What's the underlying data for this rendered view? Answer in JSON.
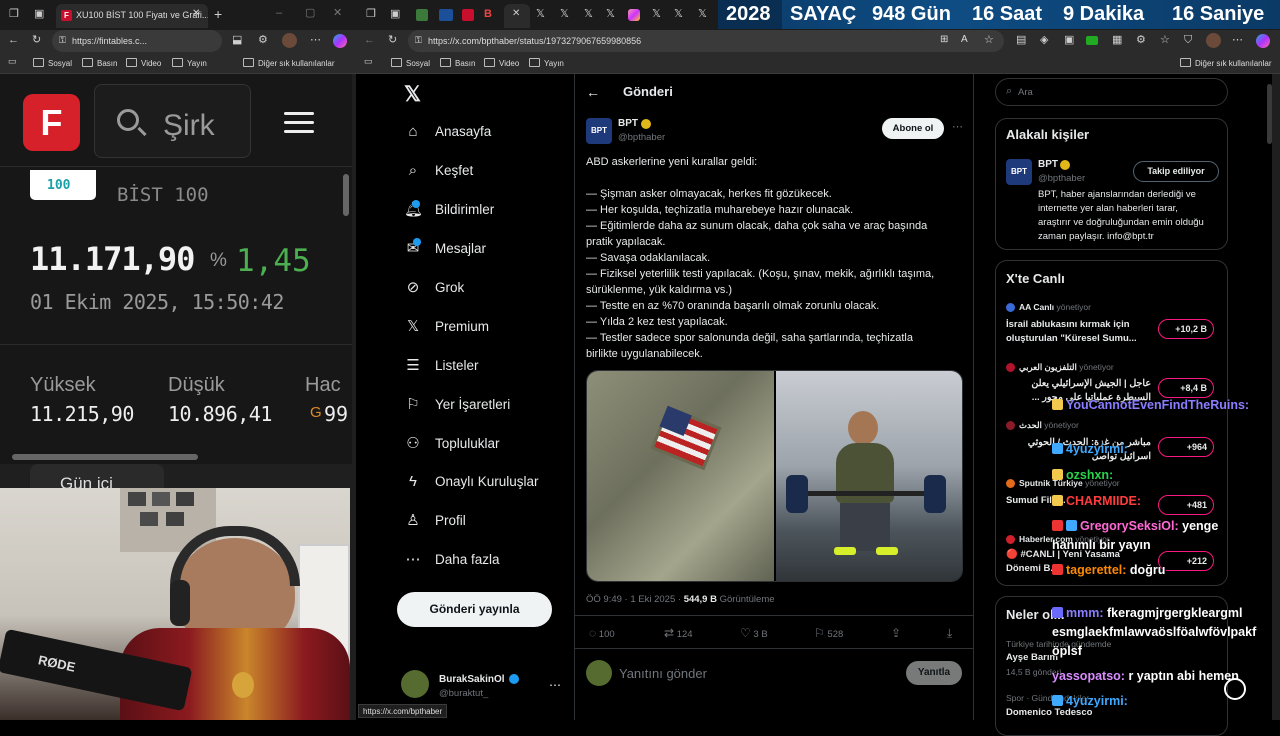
{
  "left_browser": {
    "tab_title": "XU100 BİST 100 Fiyatı ve Grafi...",
    "url": "https://fintables.c...",
    "bookmarks": [
      "Sosyal",
      "Basın",
      "Video",
      "Yayın"
    ],
    "bookmarks_other": "Diğer sık kullanılanlar"
  },
  "fintables": {
    "logo_letter": "F",
    "search_placeholder": "Şirk",
    "index_badge": "100",
    "index_name": "BİST 100",
    "price": "11.171,90",
    "change_symbol": "%",
    "change_value": "1,45",
    "change_color": "#4caf50",
    "datetime": "01 Ekim 2025, 15:50:42",
    "stats": [
      {
        "label": "Yüksek",
        "value": "11.215,90"
      },
      {
        "label": "Düşük",
        "value": "10.896,41"
      },
      {
        "label": "Hac",
        "value": "99"
      }
    ],
    "tab_partial": "Gün içi"
  },
  "webcam": {
    "mic_brand": "RØDE"
  },
  "right_browser": {
    "url": "https://x.com/bpthaber/status/1973279067659980856",
    "bookmarks": [
      "Sosyal",
      "Basın",
      "Video",
      "Yayın"
    ],
    "bookmarks_other": "Diğer sık kullanılanlar",
    "status_url": "https://x.com/bpthaber"
  },
  "countdown": {
    "year": "2028",
    "label": "SAYAÇ",
    "days": "948 Gün",
    "hours": "16 Saat",
    "minutes": "9 Dakika",
    "seconds": "16 Saniye"
  },
  "x_nav": {
    "items": [
      "Anasayfa",
      "Keşfet",
      "Bildirimler",
      "Mesajlar",
      "Grok",
      "Premium",
      "Listeler",
      "Yer İşaretleri",
      "Topluluklar",
      "Onaylı Kuruluşlar",
      "Profil",
      "Daha fazla"
    ],
    "post_button": "Gönderi yayınla",
    "account_name": "BurakSakinOl",
    "account_handle": "@buraktut_"
  },
  "post": {
    "header_title": "Gönderi",
    "author_name": "BPT",
    "author_handle": "@bpthaber",
    "avatar_text": "BPT",
    "follow_label": "Abone ol",
    "text_lines": [
      "ABD askerlerine yeni kurallar geldi:",
      "",
      "— Şişman asker olmayacak, herkes fit gözükecek.",
      "— Her koşulda, teçhizatla muharebeye hazır olunacak.",
      "— Eğitimlerde daha az sunum olacak, daha çok saha ve araç başında",
      "pratik yapılacak.",
      "— Savaşa odaklanılacak.",
      "— Fiziksel yeterlilik testi yapılacak. (Koşu, şınav, mekik, ağırlıklı taşıma,",
      "sürüklenme, yük kaldırma vs.)",
      "— Testte en az %70 oranında başarılı olmak zorunlu olacak.",
      "— Yılda 2 kez test yapılacak.",
      "— Testler sadece spor salonunda değil, saha şartlarında, teçhizatla",
      "birlikte uygulanabilecek."
    ],
    "time": "ÖÖ 9:49 · 1 Eki 2025 ·",
    "views": "544,9 B",
    "views_label": "Görüntüleme",
    "replies": "100",
    "reposts": "124",
    "likes": "3 B",
    "bookmarks": "528",
    "reply_placeholder": "Yanıtını gönder",
    "reply_button": "Yanıtla"
  },
  "sidebar": {
    "search_placeholder": "Ara",
    "related_title": "Alakalı kişiler",
    "related": {
      "name": "BPT",
      "handle": "@bpthaber",
      "button": "Takip ediliyor",
      "bio": [
        "BPT, haber ajanslarından derlediği ve",
        "internette yer alan haberleri tarar,",
        "araştırır ve doğruluğundan emin olduğu",
        "zaman paylaşır. info@bpt.tr"
      ]
    },
    "live_title": "X'te Canlı",
    "live": [
      {
        "host": "AA Canlı",
        "role": "yönetiyor",
        "title": [
          "İsrail ablukasını kırmak için",
          "oluşturulan \"Küresel Sumu..."
        ],
        "count": "+10,2 B"
      },
      {
        "host": "التلفزيون العربي",
        "role": "yönetiyor",
        "title": [
          "عاجل | الجيش الإسرائيلي يعلن",
          "السيطرة عملياتيا على محور ..."
        ],
        "count": "+8,4 B"
      },
      {
        "host": "الحدث",
        "role": "yönetiyor",
        "title": [
          "مباشر من غزة: الحدث / الحوثي",
          "اسرائيل تواصل"
        ],
        "count": "+964"
      },
      {
        "host": "Sputnik Türkiye",
        "role": "yönetiyor",
        "title": [
          "Sumud Filo..."
        ],
        "count": "+481"
      },
      {
        "host": "Haberler.com",
        "role": "yönetiyor",
        "title": [
          "🔴 #CANLI | Yeni Yasama",
          "Dönemi B..."
        ],
        "count": "+212"
      }
    ],
    "trends_title": "Neler ol...",
    "trends": [
      {
        "context": "Türkiye tarihinde gündemde",
        "name": "Ayşe Barım",
        "count": "14,5 B gönderi"
      },
      {
        "context": "Spor · Gündemdekiler",
        "name": "Domenico Tedesco",
        "count": ""
      }
    ]
  },
  "chat": [
    {
      "user": "YouCannotEvenFindTheRuins:",
      "msg": "",
      "color": "#8a7dff"
    },
    {
      "user": "4yuzyirmi:",
      "msg": "",
      "color": "#3fa9ff"
    },
    {
      "user": "ozshxn:",
      "msg": "",
      "color": "#28d24a"
    },
    {
      "user": "CHARMIIDE:",
      "msg": "",
      "color": "#ff3b3b"
    },
    {
      "user": "GregorySeksiOl:",
      "msg": "yenge",
      "color": "#ff6ad5"
    },
    {
      "user": "",
      "msg": "hanımlı bir yayın",
      "color": "#ffffff"
    },
    {
      "user": "tagerettel:",
      "msg": "doğru",
      "color": "#ff8a00"
    },
    {
      "user": "mmm:",
      "msg": "fkeragmjrgergkleargml",
      "color": "#8a7dff"
    },
    {
      "user": "",
      "msg": "esmglaekfmlawvaöslföalwfövlpakf",
      "color": "#ffffff"
    },
    {
      "user": "",
      "msg": "öplsf",
      "color": "#ffffff"
    },
    {
      "user": "yassopatso:",
      "msg": "r yaptın abi hemen",
      "color": "#d98cff"
    },
    {
      "user": "4yuzyirmi:",
      "msg": "",
      "color": "#3fa9ff"
    }
  ]
}
